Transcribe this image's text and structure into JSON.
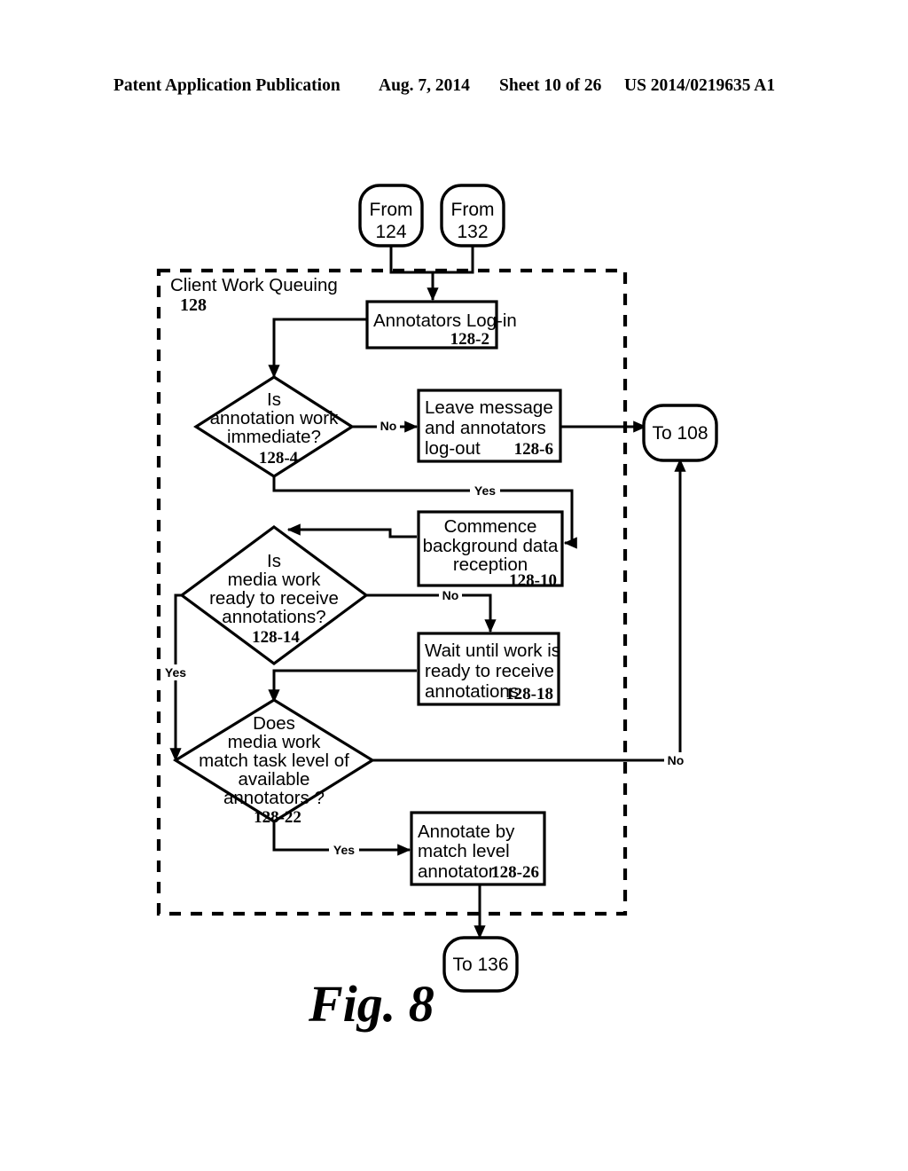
{
  "header": {
    "publication": "Patent Application Publication",
    "date": "Aug. 7, 2014",
    "sheet": "Sheet 10 of 26",
    "patent_number": "US 2014/0219635 A1"
  },
  "figure": {
    "caption": "Fig. 8",
    "group": {
      "title": "Client Work Queuing",
      "ref": "128"
    },
    "terminators": {
      "from_124": "From\n124",
      "from_124_line1": "From",
      "from_124_line2": "124",
      "from_132_line1": "From",
      "from_132_line2": "132",
      "to_108": "To 108",
      "to_136": "To 136"
    },
    "nodes": [
      {
        "id": "128-2",
        "shape": "process",
        "lines": [
          "Annotators Log-in"
        ],
        "ref": "128-2"
      },
      {
        "id": "128-4",
        "shape": "decision",
        "lines": [
          "Is",
          "annotation work",
          "immediate?"
        ],
        "ref": "128-4"
      },
      {
        "id": "128-6",
        "shape": "process",
        "lines": [
          "Leave message",
          "and annotators",
          "log-out"
        ],
        "ref": "128-6"
      },
      {
        "id": "128-10",
        "shape": "process",
        "lines": [
          "Commence",
          "background data",
          "reception"
        ],
        "ref": "128-10"
      },
      {
        "id": "128-14",
        "shape": "decision",
        "lines": [
          "Is",
          "media work",
          "ready to receive",
          "annotations?"
        ],
        "ref": "128-14"
      },
      {
        "id": "128-18",
        "shape": "process",
        "lines": [
          "Wait until work is",
          "ready to receive",
          "annotations"
        ],
        "ref": "128-18"
      },
      {
        "id": "128-22",
        "shape": "decision",
        "lines": [
          "Does",
          "media work",
          "match task level of",
          "available",
          "annotators ?"
        ],
        "ref": "128-22"
      },
      {
        "id": "128-26",
        "shape": "process",
        "lines": [
          "Annotate by",
          "match level",
          "annotator"
        ],
        "ref": "128-26"
      }
    ],
    "edge_labels": {
      "d4_no": "No",
      "d4_yes": "Yes",
      "d14_no": "No",
      "d14_yes": "Yes",
      "d22_no": "No",
      "d22_yes": "Yes"
    }
  }
}
